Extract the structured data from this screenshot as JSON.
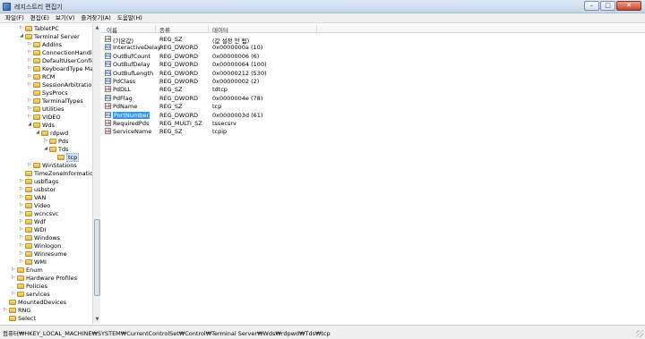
{
  "window": {
    "title": "레지스트리 편집기",
    "min_label": "–",
    "max_label": "□",
    "close_label": "✕"
  },
  "menu": [
    "파일(F)",
    "편집(E)",
    "보기(V)",
    "즐겨찾기(A)",
    "도움말(H)"
  ],
  "tree": [
    {
      "label": "TabletPC",
      "level": 3,
      "exp": "▷"
    },
    {
      "label": "Terminal Server",
      "level": 3,
      "exp": "◢"
    },
    {
      "label": "AddIns",
      "level": 4,
      "exp": "▷"
    },
    {
      "label": "ConnectionHandler",
      "level": 4,
      "exp": "▷"
    },
    {
      "label": "DefaultUserConfig",
      "level": 4,
      "exp": "▷"
    },
    {
      "label": "KeyboardType Mapping",
      "level": 4,
      "exp": "▷"
    },
    {
      "label": "RCM",
      "level": 4,
      "exp": "▷"
    },
    {
      "label": "SessionArbitration",
      "level": 4,
      "exp": "▷"
    },
    {
      "label": "SysProcs",
      "level": 4,
      "exp": ""
    },
    {
      "label": "TerminalTypes",
      "level": 4,
      "exp": "▷"
    },
    {
      "label": "Utilities",
      "level": 4,
      "exp": "▷"
    },
    {
      "label": "VIDEO",
      "level": 4,
      "exp": "▷"
    },
    {
      "label": "Wds",
      "level": 4,
      "exp": "◢"
    },
    {
      "label": "rdpwd",
      "level": 5,
      "exp": "◢"
    },
    {
      "label": "Pds",
      "level": 6,
      "exp": "▷"
    },
    {
      "label": "Tds",
      "level": 6,
      "exp": "◢"
    },
    {
      "label": "tcp",
      "level": 7,
      "exp": "",
      "selected": true
    },
    {
      "label": "WinStations",
      "level": 4,
      "exp": "▷"
    },
    {
      "label": "TimeZoneInformation",
      "level": 3,
      "exp": ""
    },
    {
      "label": "usbflags",
      "level": 3,
      "exp": "▷"
    },
    {
      "label": "usbstor",
      "level": 3,
      "exp": "▷"
    },
    {
      "label": "VAN",
      "level": 3,
      "exp": "▷"
    },
    {
      "label": "Video",
      "level": 3,
      "exp": "▷"
    },
    {
      "label": "wcncsvc",
      "level": 3,
      "exp": "▷"
    },
    {
      "label": "Wdf",
      "level": 3,
      "exp": "▷"
    },
    {
      "label": "WDI",
      "level": 3,
      "exp": "▷"
    },
    {
      "label": "Windows",
      "level": 3,
      "exp": "▷"
    },
    {
      "label": "Winlogon",
      "level": 3,
      "exp": "▷"
    },
    {
      "label": "Winresume",
      "level": 3,
      "exp": "▷"
    },
    {
      "label": "WMI",
      "level": 3,
      "exp": "▷"
    },
    {
      "label": "Enum",
      "level": 2,
      "exp": "▷"
    },
    {
      "label": "Hardware Profiles",
      "level": 2,
      "exp": "▷"
    },
    {
      "label": "Policies",
      "level": 2,
      "exp": ""
    },
    {
      "label": "services",
      "level": 2,
      "exp": "▷"
    },
    {
      "label": "MountedDevices",
      "level": 1,
      "exp": ""
    },
    {
      "label": "RNG",
      "level": 1,
      "exp": "▷"
    },
    {
      "label": "Select",
      "level": 1,
      "exp": ""
    }
  ],
  "columns": {
    "name": "이름",
    "type": "종류",
    "data": "데이터"
  },
  "values": [
    {
      "icon": "ab",
      "name": "(기본값)",
      "type": "REG_SZ",
      "data": "(값 설정 안 됨)"
    },
    {
      "icon": "bin",
      "name": "InteractiveDelay",
      "type": "REG_DWORD",
      "data": "0x0000000a (10)"
    },
    {
      "icon": "bin",
      "name": "OutBufCount",
      "type": "REG_DWORD",
      "data": "0x00000006 (6)"
    },
    {
      "icon": "bin",
      "name": "OutBufDelay",
      "type": "REG_DWORD",
      "data": "0x00000064 (100)"
    },
    {
      "icon": "bin",
      "name": "OutBufLength",
      "type": "REG_DWORD",
      "data": "0x00000212 (530)"
    },
    {
      "icon": "bin",
      "name": "PdClass",
      "type": "REG_DWORD",
      "data": "0x00000002 (2)"
    },
    {
      "icon": "ab",
      "name": "PdDLL",
      "type": "REG_SZ",
      "data": "tdtcp"
    },
    {
      "icon": "bin",
      "name": "PdFlag",
      "type": "REG_DWORD",
      "data": "0x0000004e (78)"
    },
    {
      "icon": "ab",
      "name": "PdName",
      "type": "REG_SZ",
      "data": "tcp"
    },
    {
      "icon": "bin",
      "name": "PortNumber",
      "type": "REG_DWORD",
      "data": "0x0000003d (61)",
      "selected": true
    },
    {
      "icon": "ab",
      "name": "RequiredPds",
      "type": "REG_MULTI_SZ",
      "data": "tssecsrv"
    },
    {
      "icon": "ab",
      "name": "ServiceName",
      "type": "REG_SZ",
      "data": "tcpip"
    }
  ],
  "status": {
    "path": "컴퓨터₩HKEY_LOCAL_MACHINE₩SYSTEM₩CurrentControlSet₩Control₩Terminal Server₩Wds₩rdpwd₩Tds₩tcp"
  },
  "colors": {
    "selection": "#3399ff",
    "tree_selection": "#cfe3fc"
  }
}
